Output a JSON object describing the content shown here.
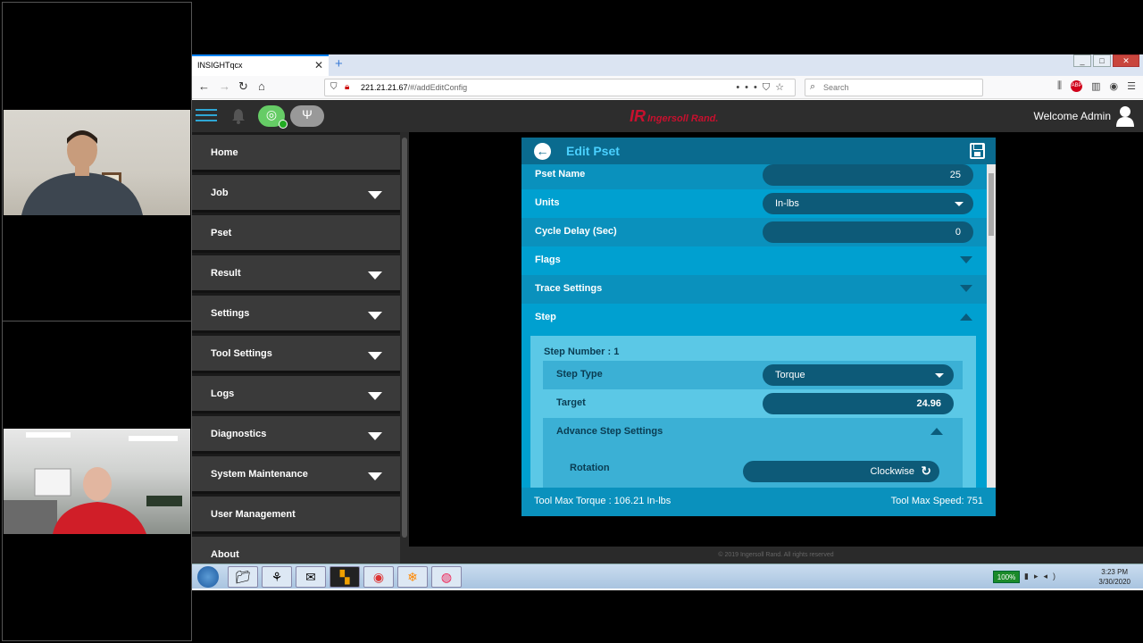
{
  "browser": {
    "tab_title": "INSIGHTqcx",
    "tab_close": "✕",
    "new_tab": "+",
    "url_host": "221.21.21.67",
    "url_path": "/#/addEditConfig",
    "search_placeholder": "Search"
  },
  "app": {
    "welcome": "Welcome Admin",
    "logo_mark": "IR",
    "logo_text": "Ingersoll Rand.",
    "footer": "© 2019 Ingersoll Rand. All rights reserved"
  },
  "sidebar": {
    "items": [
      {
        "label": "Home",
        "caret": false
      },
      {
        "label": "Job",
        "caret": true
      },
      {
        "label": "Pset",
        "caret": false
      },
      {
        "label": "Result",
        "caret": true
      },
      {
        "label": "Settings",
        "caret": true
      },
      {
        "label": "Tool Settings",
        "caret": true
      },
      {
        "label": "Logs",
        "caret": true
      },
      {
        "label": "Diagnostics",
        "caret": true
      },
      {
        "label": "System Maintenance",
        "caret": true
      },
      {
        "label": "User Management",
        "caret": false
      },
      {
        "label": "About",
        "caret": false
      }
    ]
  },
  "pset": {
    "title": "Edit Pset",
    "name_label": "Pset Name",
    "name_value": "25",
    "units_label": "Units",
    "units_value": "In-lbs",
    "cycle_delay_label": "Cycle Delay (Sec)",
    "cycle_delay_value": "0",
    "flags_label": "Flags",
    "trace_label": "Trace Settings",
    "step_label": "Step",
    "step_number": "Step Number : 1",
    "step_type_label": "Step Type",
    "step_type_value": "Torque",
    "target_label": "Target",
    "target_value": "24.96",
    "advance_label": "Advance Step Settings",
    "rotation_label": "Rotation",
    "rotation_value": "Clockwise",
    "tool_max_torque": "Tool Max Torque : 106.21 In-lbs",
    "tool_max_speed": "Tool Max Speed: 751"
  },
  "taskbar": {
    "battery": "100%",
    "time": "3:23 PM",
    "date": "3/30/2020"
  }
}
